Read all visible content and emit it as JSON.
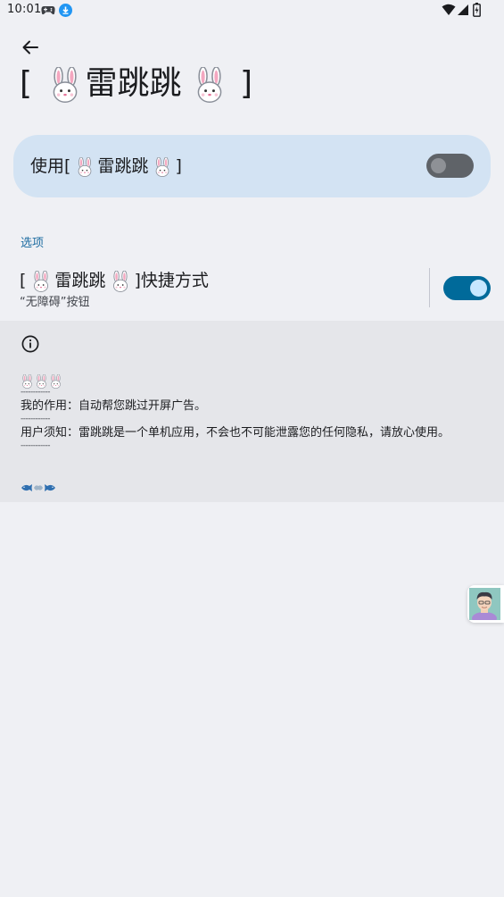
{
  "status_bar": {
    "time": "10:01",
    "icons": [
      "gamepad-icon",
      "download-icon",
      "wifi-icon",
      "signal-icon",
      "battery-icon"
    ]
  },
  "header": {
    "back_icon": "arrow-left-icon",
    "title_open": "[",
    "title_name": "雷跳跳",
    "title_close": "]"
  },
  "main_toggle": {
    "label_prefix": "使用[",
    "label_name": "雷跳跳",
    "label_suffix": "]",
    "enabled": false
  },
  "options": {
    "heading": "选项",
    "shortcut": {
      "title_prefix": "[",
      "title_name": "雷跳跳",
      "title_suffix": "]快捷方式",
      "summary": "“无障碍”按钮",
      "enabled": true
    }
  },
  "info": {
    "icon": "info-icon",
    "dashes": "------------",
    "line_purpose": "我的作用：自动帮您跳过开屏广告。",
    "line_notice": "用户须知：雷跳跳是一个单机应用，不会也不可能泄露您的任何隐私，请放心使用。"
  },
  "colors": {
    "background": "#eff0f4",
    "card": "#d3e3f3",
    "accent": "#006a9a",
    "heading": "#1b6ba0",
    "info_panel": "#e5e6ea"
  }
}
